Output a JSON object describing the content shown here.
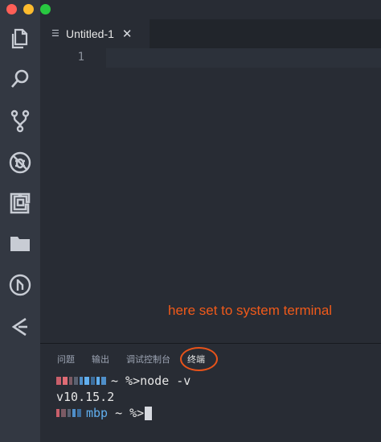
{
  "tab": {
    "label": "Untitled-1",
    "close": "✕"
  },
  "editor": {
    "line_numbers": [
      "1"
    ]
  },
  "annotation": "here set to system terminal",
  "panel": {
    "tabs": [
      "问题",
      "输出",
      "调试控制台",
      "终端"
    ],
    "active_tab": "终端"
  },
  "terminal": {
    "line1": {
      "prompt_suffix": "~ %>",
      "command": "node -v"
    },
    "line2": {
      "output": "v10.15.2"
    },
    "line3": {
      "host_suffix": "mbp",
      "prompt_suffix": "~ %>"
    }
  },
  "colors": {
    "annotation": "#f05a1a",
    "circle": "#e8531a",
    "background": "#282c34",
    "activity_bar": "#333842"
  },
  "icons": [
    "explorer-icon",
    "search-icon",
    "source-control-icon",
    "debug-icon",
    "extensions-icon",
    "folder-icon",
    "git-graph-icon",
    "gitlens-icon"
  ]
}
